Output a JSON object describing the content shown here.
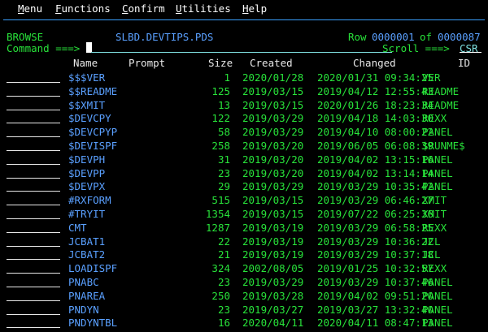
{
  "menu": {
    "items": [
      {
        "hot": "M",
        "rest": "enu"
      },
      {
        "hot": "F",
        "rest": "unctions"
      },
      {
        "hot": "C",
        "rest": "onfirm"
      },
      {
        "hot": "U",
        "rest": "tilities"
      },
      {
        "hot": "H",
        "rest": "elp"
      }
    ]
  },
  "status": {
    "mode": "BROWSE",
    "dataset": "SLBD.DEVTIPS.PDS",
    "row_label": "Row",
    "row_current": "0000001",
    "row_of": "of",
    "row_total": "0000087"
  },
  "command": {
    "label": "Command ===>",
    "value": "",
    "scroll_label": "Scroll ===>",
    "scroll_value": "CSR"
  },
  "columns": {
    "name": "Name",
    "prompt": "Prompt",
    "size": "Size",
    "created": "Created",
    "changed": "Changed",
    "id": "ID"
  },
  "members": [
    {
      "name": "$$$VER",
      "size": "1",
      "created": "2020/01/28",
      "changed": "2020/01/31 09:34:25",
      "id": "VER"
    },
    {
      "name": "$$README",
      "size": "125",
      "created": "2019/03/15",
      "changed": "2019/04/12 12:55:43",
      "id": "README"
    },
    {
      "name": "$$XMIT",
      "size": "13",
      "created": "2019/03/15",
      "changed": "2020/01/26 18:23:34",
      "id": "README"
    },
    {
      "name": "$DEVCPY",
      "size": "122",
      "created": "2019/03/29",
      "changed": "2019/04/18 14:03:30",
      "id": "REXX"
    },
    {
      "name": "$DEVCPYP",
      "size": "58",
      "created": "2019/03/29",
      "changed": "2019/04/10 08:00:22",
      "id": "PANEL"
    },
    {
      "name": "$DEVISPF",
      "size": "258",
      "created": "2019/03/20",
      "changed": "2019/06/05 06:08:39",
      "id": "$RUNME$"
    },
    {
      "name": "$DEVPH",
      "size": "31",
      "created": "2019/03/20",
      "changed": "2019/04/02 13:15:16",
      "id": "PANEL"
    },
    {
      "name": "$DEVPP",
      "size": "23",
      "created": "2019/03/20",
      "changed": "2019/04/02 13:14:14",
      "id": "PANEL"
    },
    {
      "name": "$DEVPX",
      "size": "29",
      "created": "2019/03/29",
      "changed": "2019/03/29 10:35:42",
      "id": "PANEL"
    },
    {
      "name": "#RXFORM",
      "size": "515",
      "created": "2019/03/15",
      "changed": "2019/03/29 06:46:27",
      "id": "XMIT"
    },
    {
      "name": "#TRYIT",
      "size": "1354",
      "created": "2019/03/15",
      "changed": "2019/07/22 06:25:36",
      "id": "XMIT"
    },
    {
      "name": "CMT",
      "size": "1287",
      "created": "2019/03/19",
      "changed": "2019/03/29 06:58:25",
      "id": "REXX"
    },
    {
      "name": "JCBAT1",
      "size": "22",
      "created": "2019/03/19",
      "changed": "2019/03/29 10:36:22",
      "id": "JCL"
    },
    {
      "name": "JCBAT2",
      "size": "21",
      "created": "2019/03/19",
      "changed": "2019/03/29 10:37:18",
      "id": "JCL"
    },
    {
      "name": "LOADISPF",
      "size": "324",
      "created": "2002/08/05",
      "changed": "2019/01/25 10:32:57",
      "id": "REXX"
    },
    {
      "name": "PNABC",
      "size": "23",
      "created": "2019/03/29",
      "changed": "2019/03/29 10:37:46",
      "id": "PANEL"
    },
    {
      "name": "PNAREA",
      "size": "250",
      "created": "2019/03/28",
      "changed": "2019/04/02 09:51:20",
      "id": "PANEL"
    },
    {
      "name": "PNDYN",
      "size": "23",
      "created": "2019/03/27",
      "changed": "2019/03/27 13:32:40",
      "id": "PANEL"
    },
    {
      "name": "PNDYNTBL",
      "size": "16",
      "created": "2020/04/11",
      "changed": "2020/04/11 08:47:13",
      "id": "PANEL"
    }
  ]
}
